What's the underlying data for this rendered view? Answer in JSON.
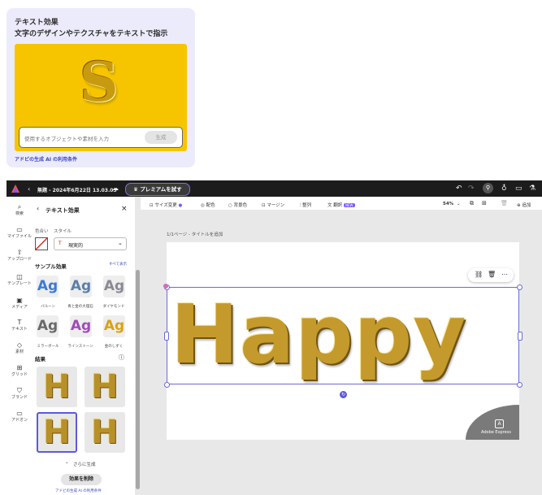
{
  "card": {
    "title": "テキスト効果",
    "subtitle": "文字のデザインやテクスチャをテキストで指示",
    "preview_letter": "S",
    "input_placeholder": "使用するオブジェクトや素材を入力",
    "generate_label": "生成",
    "terms_link": "アドビの生成 AI の利用条件"
  },
  "topbar": {
    "doc_title": "無題 - 2024年6月22日 13.03.05",
    "premium_label": "プレミアムを試す",
    "colors": {
      "bg": "#1c1c1c",
      "premium_border": "#8b6ae0"
    }
  },
  "rail": [
    {
      "icon": "search-icon",
      "glyph": "⌕",
      "label": "検索"
    },
    {
      "icon": "folder-icon",
      "glyph": "▭",
      "label": "マイファイル"
    },
    {
      "icon": "upload-icon",
      "glyph": "⇧",
      "label": "アップロード"
    },
    {
      "icon": "template-icon",
      "glyph": "◫",
      "label": "テンプレート"
    },
    {
      "icon": "media-icon",
      "glyph": "▣",
      "label": "メディア"
    },
    {
      "icon": "text-icon",
      "glyph": "T",
      "label": "テキスト"
    },
    {
      "icon": "elements-icon",
      "glyph": "◇",
      "label": "素材"
    },
    {
      "icon": "grid-icon",
      "glyph": "⊞",
      "label": "グリッド"
    },
    {
      "icon": "brand-icon",
      "glyph": "⛉",
      "label": "ブランド"
    },
    {
      "icon": "addon-icon",
      "glyph": "▭",
      "label": "アドオン"
    }
  ],
  "panel": {
    "back_title": "テキスト効果",
    "close_glyph": "×",
    "color_label": "色合い",
    "style_label": "スタイル",
    "style_value": "現実的",
    "samples_heading": "サンプル効果",
    "see_all": "すべて表示",
    "samples": [
      {
        "text": "Ag",
        "label": "バルーン",
        "color": "#3d7bd6"
      },
      {
        "text": "Ag",
        "label": "青と金の大理石",
        "color": "#5b7fa8"
      },
      {
        "text": "Ag",
        "label": "ダイヤモンド",
        "color": "#8a8a95"
      },
      {
        "text": "Ag",
        "label": "ミラーボール",
        "color": "#6a6a6a"
      },
      {
        "text": "Ag",
        "label": "ラインストーン",
        "color": "#a04bb8"
      },
      {
        "text": "Ag",
        "label": "金のしずく",
        "color": "#d8a316"
      }
    ],
    "results_heading": "結果",
    "results": [
      "H",
      "H",
      "H",
      "H"
    ],
    "more_label": "さらに生成",
    "remove_label": "効果を削除",
    "terms_link": "アドビの生成 AI の利用条件"
  },
  "toolbar": {
    "resize": "サイズ変更",
    "palette": "配色",
    "background": "背景色",
    "margin": "マージン",
    "align": "整列",
    "translate": "翻訳",
    "new_badge": "NEW",
    "zoom": "54%",
    "add": "追加"
  },
  "canvas": {
    "page_label": "1/1ページ - タイトルを追加",
    "main_text": "Happy",
    "watermark": "Adobe Express"
  }
}
